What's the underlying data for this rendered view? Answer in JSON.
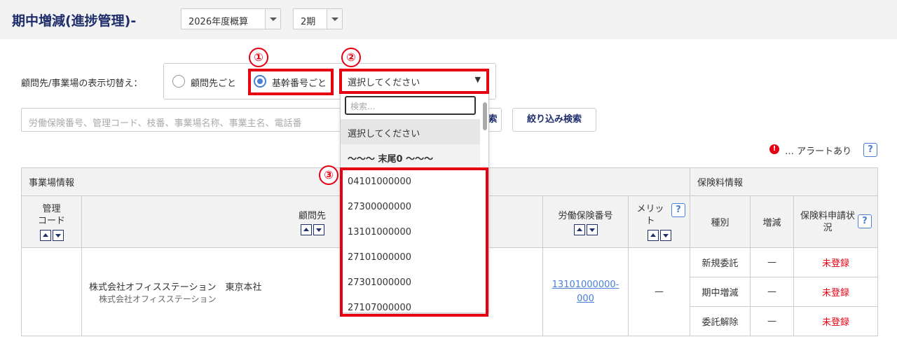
{
  "header": {
    "title": "期中増減(進捗管理)-",
    "year_select": "2026年度概算",
    "period_select": "2期"
  },
  "filter": {
    "switch_label": "顧問先/事業場の表示切替え：",
    "radio_client": "顧問先ごと",
    "radio_base_number": "基幹番号ごと",
    "base_number_select": "選択してください",
    "search_placeholder": "労働保険番号、管理コード、枝番、事業場名称、事業主名、電話番",
    "search_button_fragment": "索",
    "filter_button": "絞り込み検索"
  },
  "annotations": {
    "one": "①",
    "two": "②",
    "three": "③",
    "color": "#e60012"
  },
  "dropdown": {
    "search_placeholder": "検索...",
    "selected": "選択してください",
    "group_label": "〜〜〜 末尾0 〜〜〜",
    "options": [
      "04101000000",
      "27300000000",
      "13101000000",
      "27101000000",
      "27301000000",
      "27107000000"
    ]
  },
  "alert": {
    "dot": "!",
    "text": "… アラートあり",
    "help": "?"
  },
  "table": {
    "group_office": "事業場情報",
    "group_premium": "保険料情報",
    "col_code": "管理\nコード",
    "col_client": "顧問先",
    "col_labor_no": "労働保険番号",
    "col_merit": "メリット",
    "col_type": "種別",
    "col_change": "増減",
    "col_status": "保険料申請状況",
    "row": {
      "client_name": "株式会社オフィスステーション　東京本社",
      "client_sub": "株式会社オフィスステーション",
      "labor_no": "13101000000-000",
      "merit": "—",
      "types": [
        "新規委託",
        "期中増減",
        "委託解除"
      ],
      "changes": [
        "—",
        "—",
        "—"
      ],
      "statuses": [
        "未登録",
        "未登録",
        "未登録"
      ]
    }
  }
}
